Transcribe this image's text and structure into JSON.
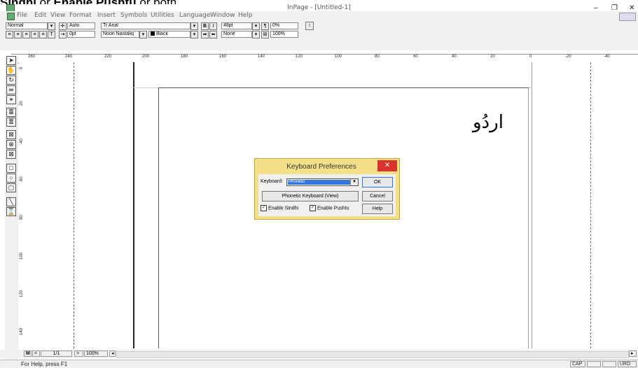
{
  "caption": {
    "bold1": "Sindhi",
    "mid": " or ",
    "bold2": "Enable Pushtu",
    "end": " or both"
  },
  "window": {
    "title": "InPage - [Untitled-1]",
    "minimize": "–",
    "maximize": "❐",
    "close": "✕"
  },
  "menu": [
    "File",
    "Edit",
    "View",
    "Format",
    "Insert",
    "Symbols",
    "Utilities",
    "Language",
    "Window",
    "Help"
  ],
  "toolbar": {
    "style": "Normal",
    "leading": "Auto",
    "font_english": "Arial",
    "bold": "B",
    "italic": "I",
    "size": "48pt",
    "tracking": "0%",
    "indent": "0pt",
    "font_urdu": "Noori Nastaliq",
    "color": "Black",
    "shade": "None",
    "scale": "100%"
  },
  "ruler": [
    "260",
    "240",
    "220",
    "200",
    "180",
    "160",
    "140",
    "120",
    "100",
    "80",
    "60",
    "40",
    "20",
    "0",
    "-20",
    "-40"
  ],
  "vruler": [
    "0",
    "20",
    "40",
    "60",
    "80",
    "100",
    "120",
    "140"
  ],
  "document": {
    "text": "اردُو"
  },
  "dialog": {
    "title": "Keyboard Preferences",
    "close": "✕",
    "keyboard_label": "Keyboard:",
    "keyboard_value": "Phonetic",
    "ok": "OK",
    "phonetic_view": "Phonetic Keyboard (View)",
    "cancel": "Cancel",
    "enable_sindhi": "Enable Sindhi",
    "enable_pushtu": "Enable Pushtu",
    "help": "Help"
  },
  "bottombar": {
    "master": "M",
    "prev": "<",
    "page": "1/1",
    "next": ">",
    "zoom": "100%"
  },
  "status": {
    "help": "For Help, press F1",
    "cap": "CAP",
    "lang": "URD"
  }
}
